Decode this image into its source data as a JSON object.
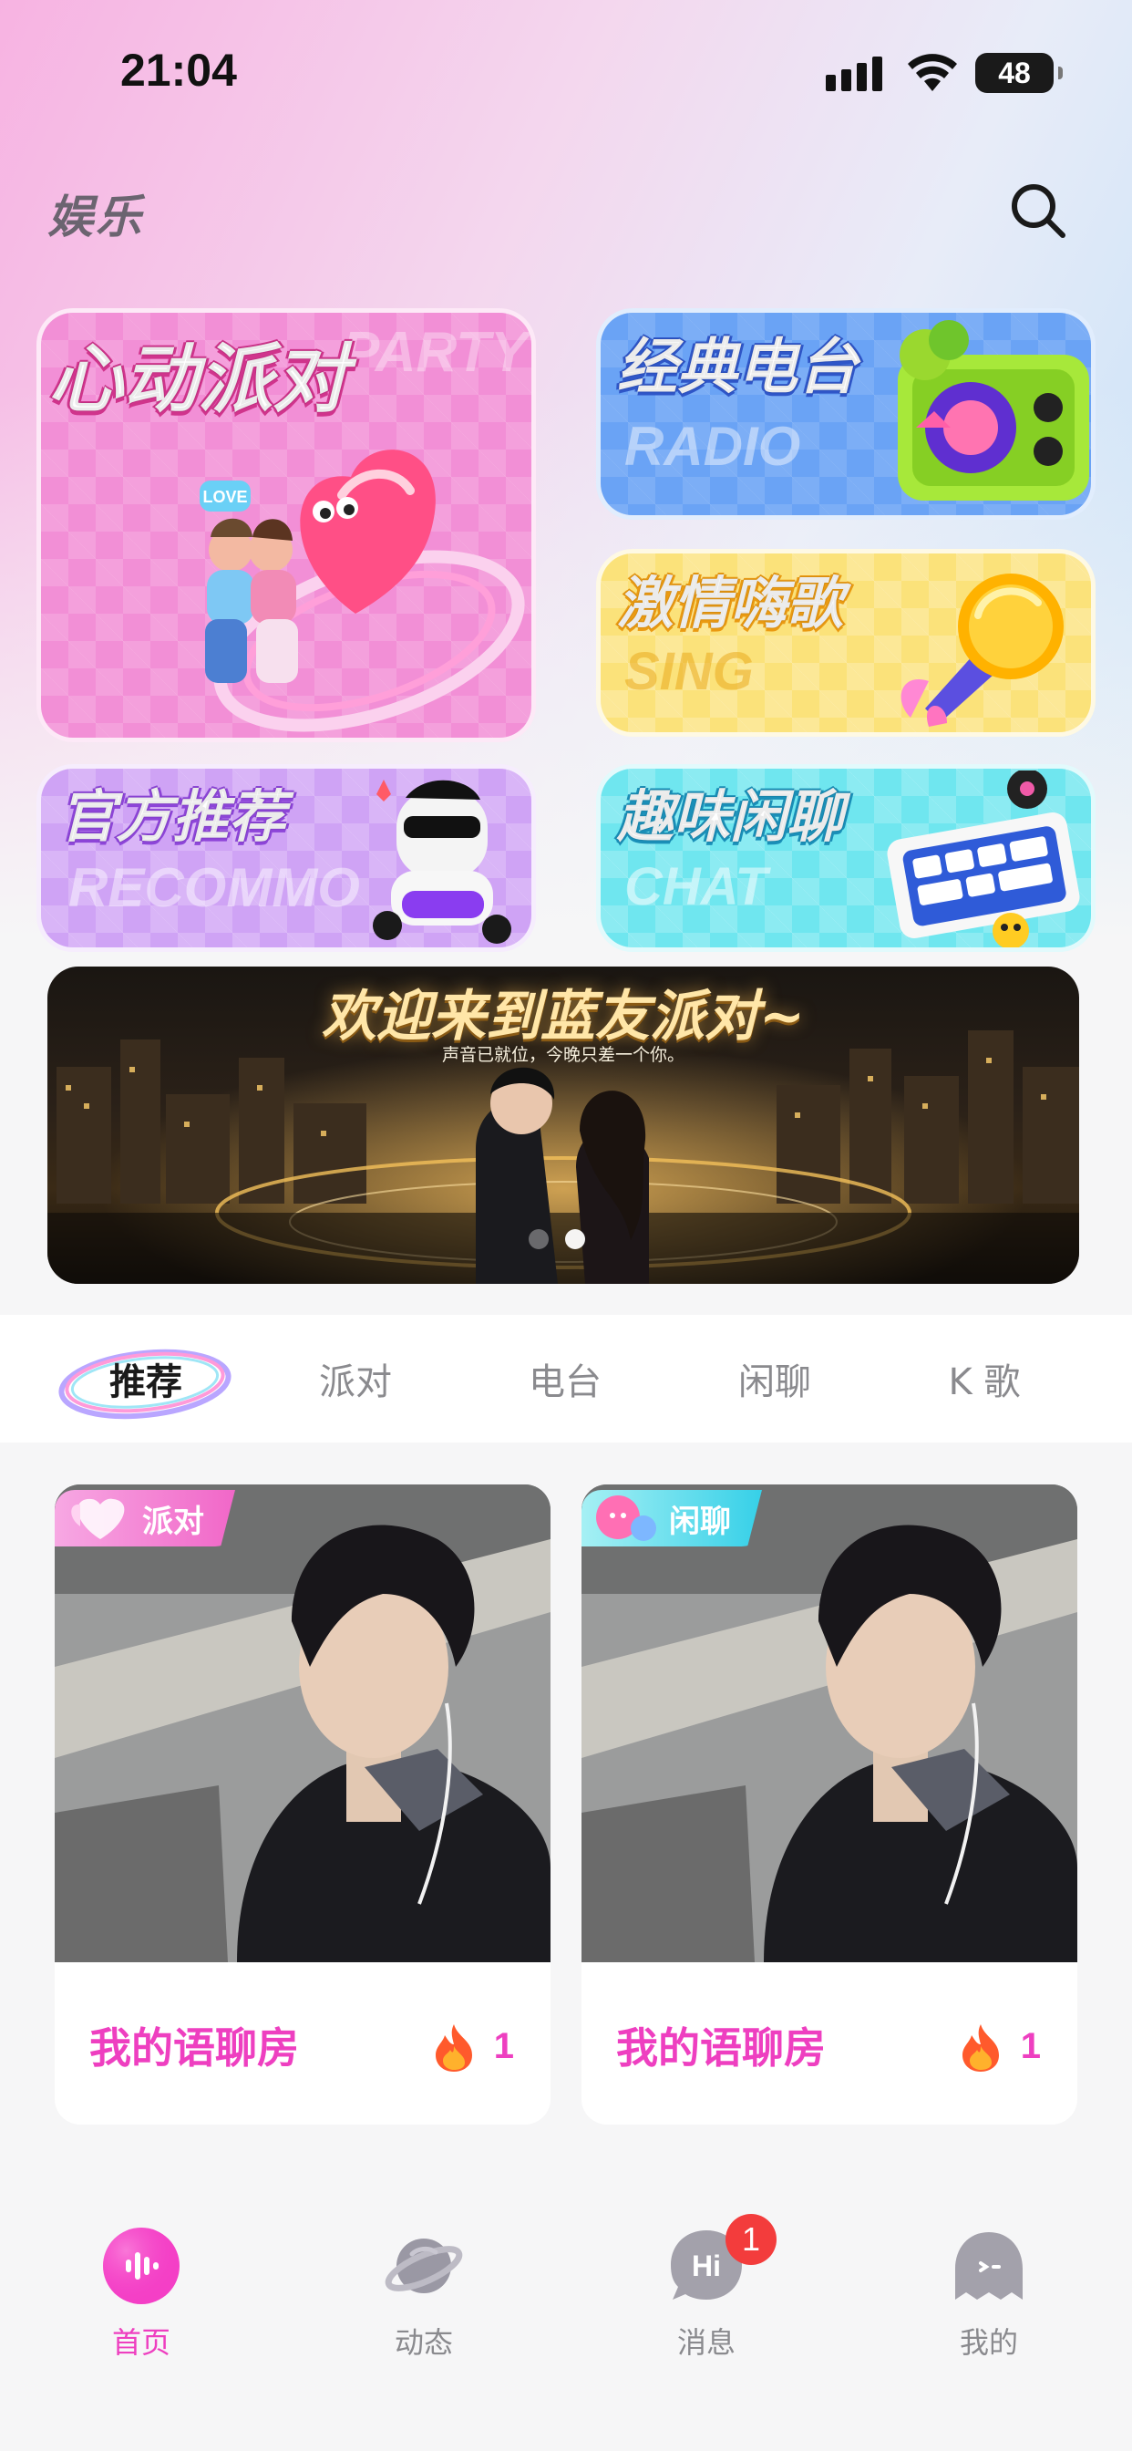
{
  "status_bar": {
    "time": "21:04",
    "battery": "48"
  },
  "header": {
    "title": "娱乐",
    "search_icon": "search-icon"
  },
  "tiles": {
    "party": {
      "title": "心动派对",
      "en": "PARTY"
    },
    "radio": {
      "title": "经典电台",
      "en": "RADIO"
    },
    "sing": {
      "title": "激情嗨歌",
      "en": "SING"
    },
    "recommend": {
      "title": "官方推荐",
      "en": "RECOMMO"
    },
    "chat": {
      "title": "趣味闲聊",
      "en": "CHAT"
    }
  },
  "banner": {
    "title": "欢迎来到蓝友派对~",
    "subtitle": "声音已就位，今晚只差一个你。",
    "slide_count": 2,
    "active_slide": 2
  },
  "tabs": [
    {
      "label": "推荐",
      "active": true
    },
    {
      "label": "派对",
      "active": false
    },
    {
      "label": "电台",
      "active": false
    },
    {
      "label": "闲聊",
      "active": false
    },
    {
      "label": "K 歌",
      "active": false
    }
  ],
  "rooms": [
    {
      "tag": "派对",
      "name": "我的语聊房",
      "heat": "1",
      "tag_color": "#f167c8"
    },
    {
      "tag": "闲聊",
      "name": "我的语聊房",
      "heat": "1",
      "tag_color": "#36d0e8"
    }
  ],
  "bottom_nav": [
    {
      "label": "首页",
      "icon": "home-voice-icon",
      "active": true
    },
    {
      "label": "动态",
      "icon": "planet-icon",
      "active": false
    },
    {
      "label": "消息",
      "icon": "message-hi-icon",
      "active": false,
      "badge": "1"
    },
    {
      "label": "我的",
      "icon": "profile-ghost-icon",
      "active": false
    }
  ],
  "colors": {
    "accent": "#ee3fc0",
    "badge": "#f33c3c"
  }
}
